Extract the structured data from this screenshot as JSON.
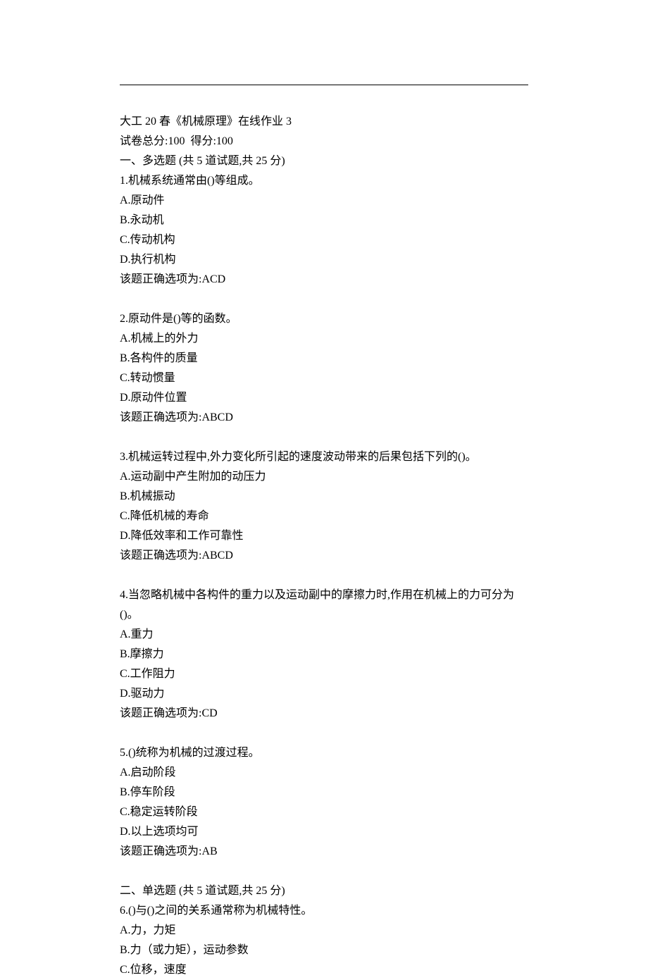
{
  "header": {
    "title": "大工 20 春《机械原理》在线作业 3",
    "score_line": "试卷总分:100  得分:100"
  },
  "section1": {
    "heading": "一、多选题 (共 5 道试题,共 25 分)",
    "questions": [
      {
        "stem": "1.机械系统通常由()等组成。",
        "options": [
          "A.原动件",
          "B.永动机",
          "C.传动机构",
          "D.执行机构"
        ],
        "answer": "该题正确选项为:ACD"
      },
      {
        "stem": "2.原动件是()等的函数。",
        "options": [
          "A.机械上的外力",
          "B.各构件的质量",
          "C.转动惯量",
          "D.原动件位置"
        ],
        "answer": "该题正确选项为:ABCD"
      },
      {
        "stem": "3.机械运转过程中,外力变化所引起的速度波动带来的后果包括下列的()。",
        "options": [
          "A.运动副中产生附加的动压力",
          "B.机械振动",
          "C.降低机械的寿命",
          "D.降低效率和工作可靠性"
        ],
        "answer": "该题正确选项为:ABCD"
      },
      {
        "stem": "4.当忽略机械中各构件的重力以及运动副中的摩擦力时,作用在机械上的力可分为()。",
        "options": [
          "A.重力",
          "B.摩擦力",
          "C.工作阻力",
          "D.驱动力"
        ],
        "answer": "该题正确选项为:CD"
      },
      {
        "stem": "5.()统称为机械的过渡过程。",
        "options": [
          "A.启动阶段",
          "B.停车阶段",
          "C.稳定运转阶段",
          "D.以上选项均可"
        ],
        "answer": "该题正确选项为:AB"
      }
    ]
  },
  "section2": {
    "heading": "二、单选题 (共 5 道试题,共 25 分)",
    "questions": [
      {
        "stem": "6.()与()之间的关系通常称为机械特性。",
        "options": [
          "A.力，力矩",
          "B.力（或力矩），运动参数",
          "C.位移，速度"
        ]
      }
    ]
  }
}
